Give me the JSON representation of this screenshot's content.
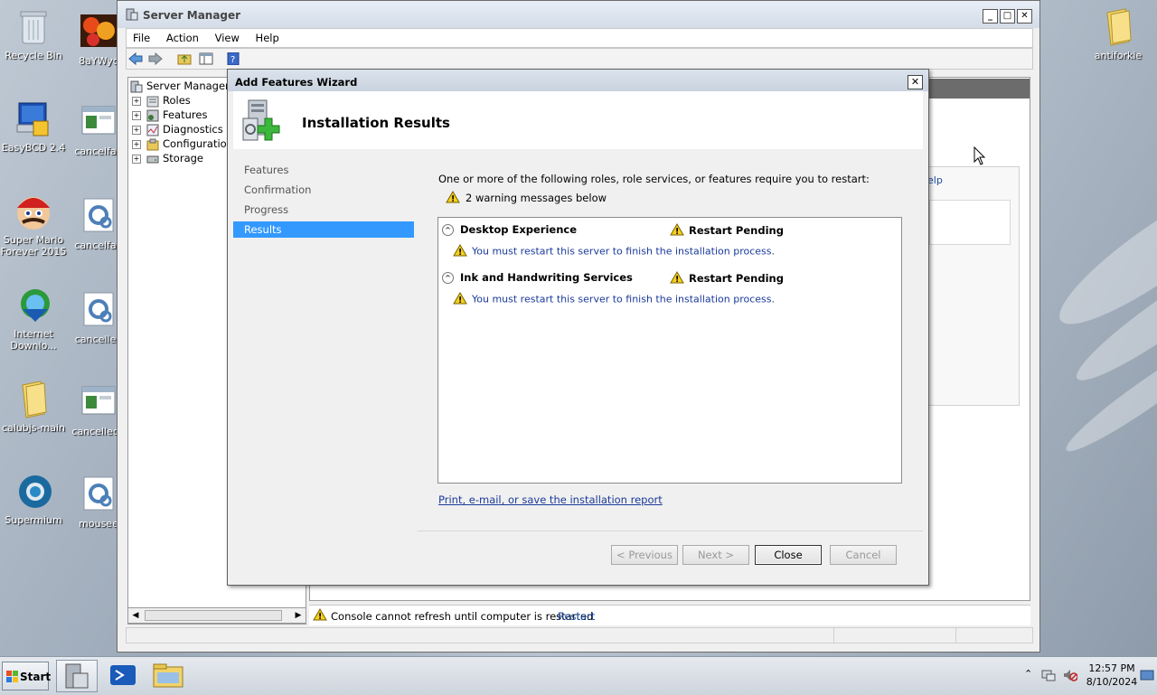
{
  "desktop": {
    "icons": [
      {
        "label": "Recycle Bin",
        "icon": "recycle-bin-icon"
      },
      {
        "label": "8aYWyc",
        "icon": "flower-image-icon"
      },
      {
        "label": "EasyBCD 2.4",
        "icon": "easybcd-icon"
      },
      {
        "label": "cancelfag",
        "icon": "window-image-icon"
      },
      {
        "label": "Super Mario Forever 2015",
        "icon": "mario-icon"
      },
      {
        "label": "cancelfag",
        "icon": "gear-file-icon"
      },
      {
        "label": "Internet Downlo...",
        "icon": "idm-icon"
      },
      {
        "label": "cancelled",
        "icon": "gear-file-icon"
      },
      {
        "label": "calubjs-main",
        "icon": "folder-icon"
      },
      {
        "label": "cancellede",
        "icon": "window-image-icon"
      },
      {
        "label": "Supermium",
        "icon": "supermium-icon"
      },
      {
        "label": "mousee",
        "icon": "gear-file-icon"
      },
      {
        "label": "antiforkie",
        "icon": "folder-icon"
      }
    ]
  },
  "server_manager": {
    "title": "Server Manager",
    "menu": [
      "File",
      "Action",
      "View",
      "Help"
    ],
    "tree": [
      {
        "label": "Server Manager (",
        "icon": "server-manager-icon"
      },
      {
        "label": "Roles",
        "icon": "roles-icon"
      },
      {
        "label": "Features",
        "icon": "features-icon"
      },
      {
        "label": "Diagnostics",
        "icon": "diagnostics-icon"
      },
      {
        "label": "Configuration",
        "icon": "configuration-icon"
      },
      {
        "label": "Storage",
        "icon": "storage-icon"
      }
    ],
    "right_help_text": "elp",
    "status_text": "Console cannot refresh until computer is restarted",
    "status_link": "Restart"
  },
  "wizard": {
    "title": "Add Features Wizard",
    "heading": "Installation Results",
    "nav": [
      "Features",
      "Confirmation",
      "Progress",
      "Results"
    ],
    "selected_nav": "Results",
    "intro": "One or more of the following roles, role services, or features require you to restart:",
    "warning_summary": "2 warning messages below",
    "results": [
      {
        "name": "Desktop Experience",
        "status": "Restart Pending",
        "message": "You must restart this server to finish the installation process."
      },
      {
        "name": "Ink and Handwriting Services",
        "status": "Restart Pending",
        "message": "You must restart this server to finish the installation process."
      }
    ],
    "report_link": "Print, e-mail, or save the installation report",
    "buttons": {
      "previous": "< Previous",
      "next": "Next >",
      "close": "Close",
      "cancel": "Cancel"
    }
  },
  "taskbar": {
    "start_label": "Start",
    "time": "12:57 PM",
    "date": "8/10/2024"
  }
}
